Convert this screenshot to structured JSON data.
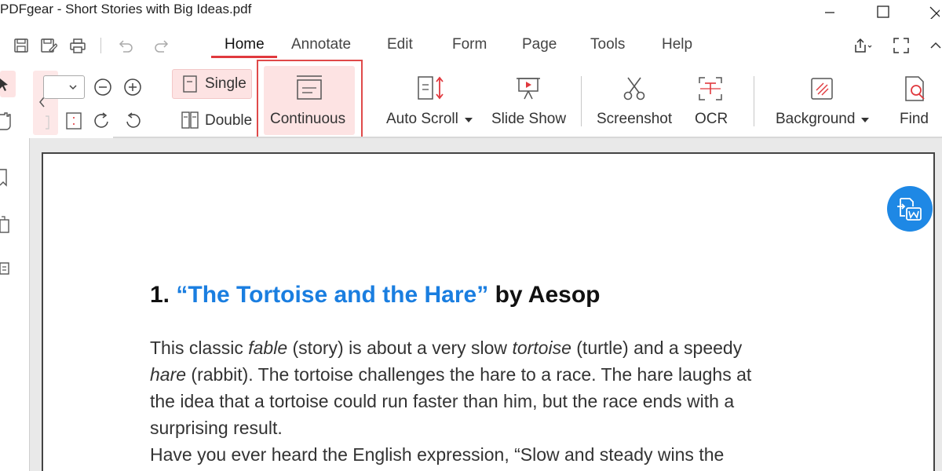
{
  "window": {
    "title": "PDFgear - Short Stories with Big Ideas.pdf"
  },
  "menu": {
    "tabs": [
      "Home",
      "Annotate",
      "Edit",
      "Form",
      "Page",
      "Tools",
      "Help"
    ],
    "active_tab": "Home"
  },
  "ribbon": {
    "single_label": "Single",
    "double_label": "Double",
    "continuous_label": "Continuous",
    "auto_scroll_label": "Auto Scroll",
    "slide_show_label": "Slide Show",
    "screenshot_label": "Screenshot",
    "ocr_label": "OCR",
    "background_label": "Background",
    "find_label": "Find",
    "highlighted_item": "Continuous"
  },
  "document": {
    "heading_number": "1.",
    "heading_title": "“The Tortoise and the Hare”",
    "heading_author": "by Aesop",
    "para1": {
      "l1_a": "This classic ",
      "l1_b": "fable",
      "l1_c": " (story) is about a very slow ",
      "l1_d": "tortoise",
      "l1_e": " (turtle) and a speedy",
      "l2_a": "hare",
      "l2_b": " (rabbit). The tortoise challenges the hare to a race. The hare laughs at",
      "l3": "the idea that a tortoise could run faster than him, but the race ends with a",
      "l4": "surprising result."
    },
    "para2_l1": "Have you ever heard the English expression, “Slow and steady wins the"
  },
  "colors": {
    "accent_red": "#e0393e",
    "link_blue": "#1a7ee0",
    "fab_blue": "#1e88e5"
  }
}
